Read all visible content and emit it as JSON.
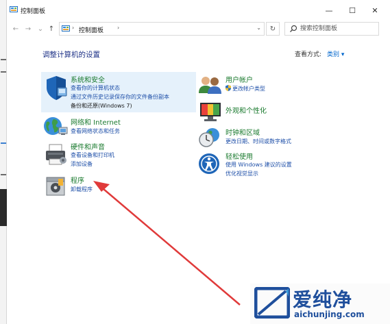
{
  "window": {
    "title": "控制面板",
    "controls": {
      "minimize": "—",
      "maximize": "☐",
      "close": "✕"
    }
  },
  "nav": {
    "back": "←",
    "forward": "→",
    "recent": "⌄",
    "up": "↑"
  },
  "address": {
    "crumb": "控制面板",
    "separator": "›",
    "dropdown": "⌄"
  },
  "refresh": "↻",
  "search": {
    "placeholder": "搜索控制面板"
  },
  "heading": "调整计算机的设置",
  "view_by": {
    "label": "查看方式:",
    "value": "类别 ▾"
  },
  "categories": [
    {
      "name": "系统和安全",
      "icon": "shield-icon",
      "links": [
        "查看你的计算机状态",
        "通过文件历史记录保存你的文件备份副本",
        "备份和还原(Windows 7)"
      ]
    },
    {
      "name": "网络和 Internet",
      "icon": "globe-icon",
      "links": [
        "查看网络状态和任务"
      ]
    },
    {
      "name": "硬件和声音",
      "icon": "printer-icon",
      "links": [
        "查看设备和打印机",
        "添加设备"
      ]
    },
    {
      "name": "程序",
      "icon": "programs-icon",
      "links": [
        "卸载程序"
      ]
    },
    {
      "name": "用户帐户",
      "icon": "users-icon",
      "links": [
        "更改帐户类型"
      ]
    },
    {
      "name": "外观和个性化",
      "icon": "monitor-icon",
      "links": []
    },
    {
      "name": "时钟和区域",
      "icon": "clock-icon",
      "links": [
        "更改日期、时间或数字格式"
      ]
    },
    {
      "name": "轻松使用",
      "icon": "accessibility-icon",
      "links": [
        "使用 Windows 建议的设置",
        "优化视觉显示"
      ]
    }
  ],
  "watermark": {
    "brand": "爱纯净",
    "url": "aichunjing.com"
  },
  "colors": {
    "category_title": "#1a7a2e",
    "link": "#1e4fa8",
    "heading": "#1e3287",
    "highlight": "#e5f1fb",
    "arrow": "#e03a3a"
  }
}
